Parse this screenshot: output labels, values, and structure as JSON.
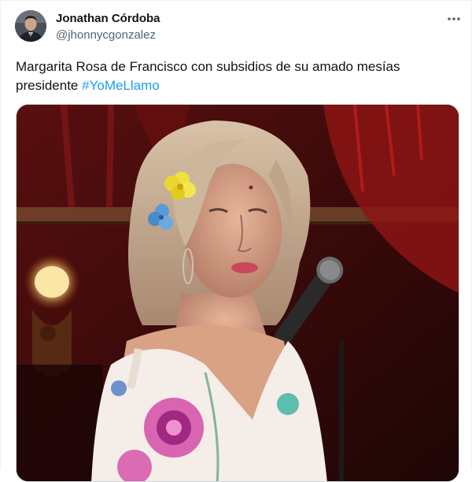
{
  "author": {
    "name": "Jonathan Córdoba",
    "handle": "@jhonnycgonzalez"
  },
  "tweet": {
    "text_prefix": "Margarita Rosa de Francisco con subsidios de su amado mesías presidente ",
    "hashtag": "#YoMeLlamo"
  },
  "icons": {
    "more": "more-horizontal-icon"
  },
  "colors": {
    "hashtag": "#1d9bf0",
    "secondary_text": "#536471",
    "primary_text": "#0f1419"
  }
}
